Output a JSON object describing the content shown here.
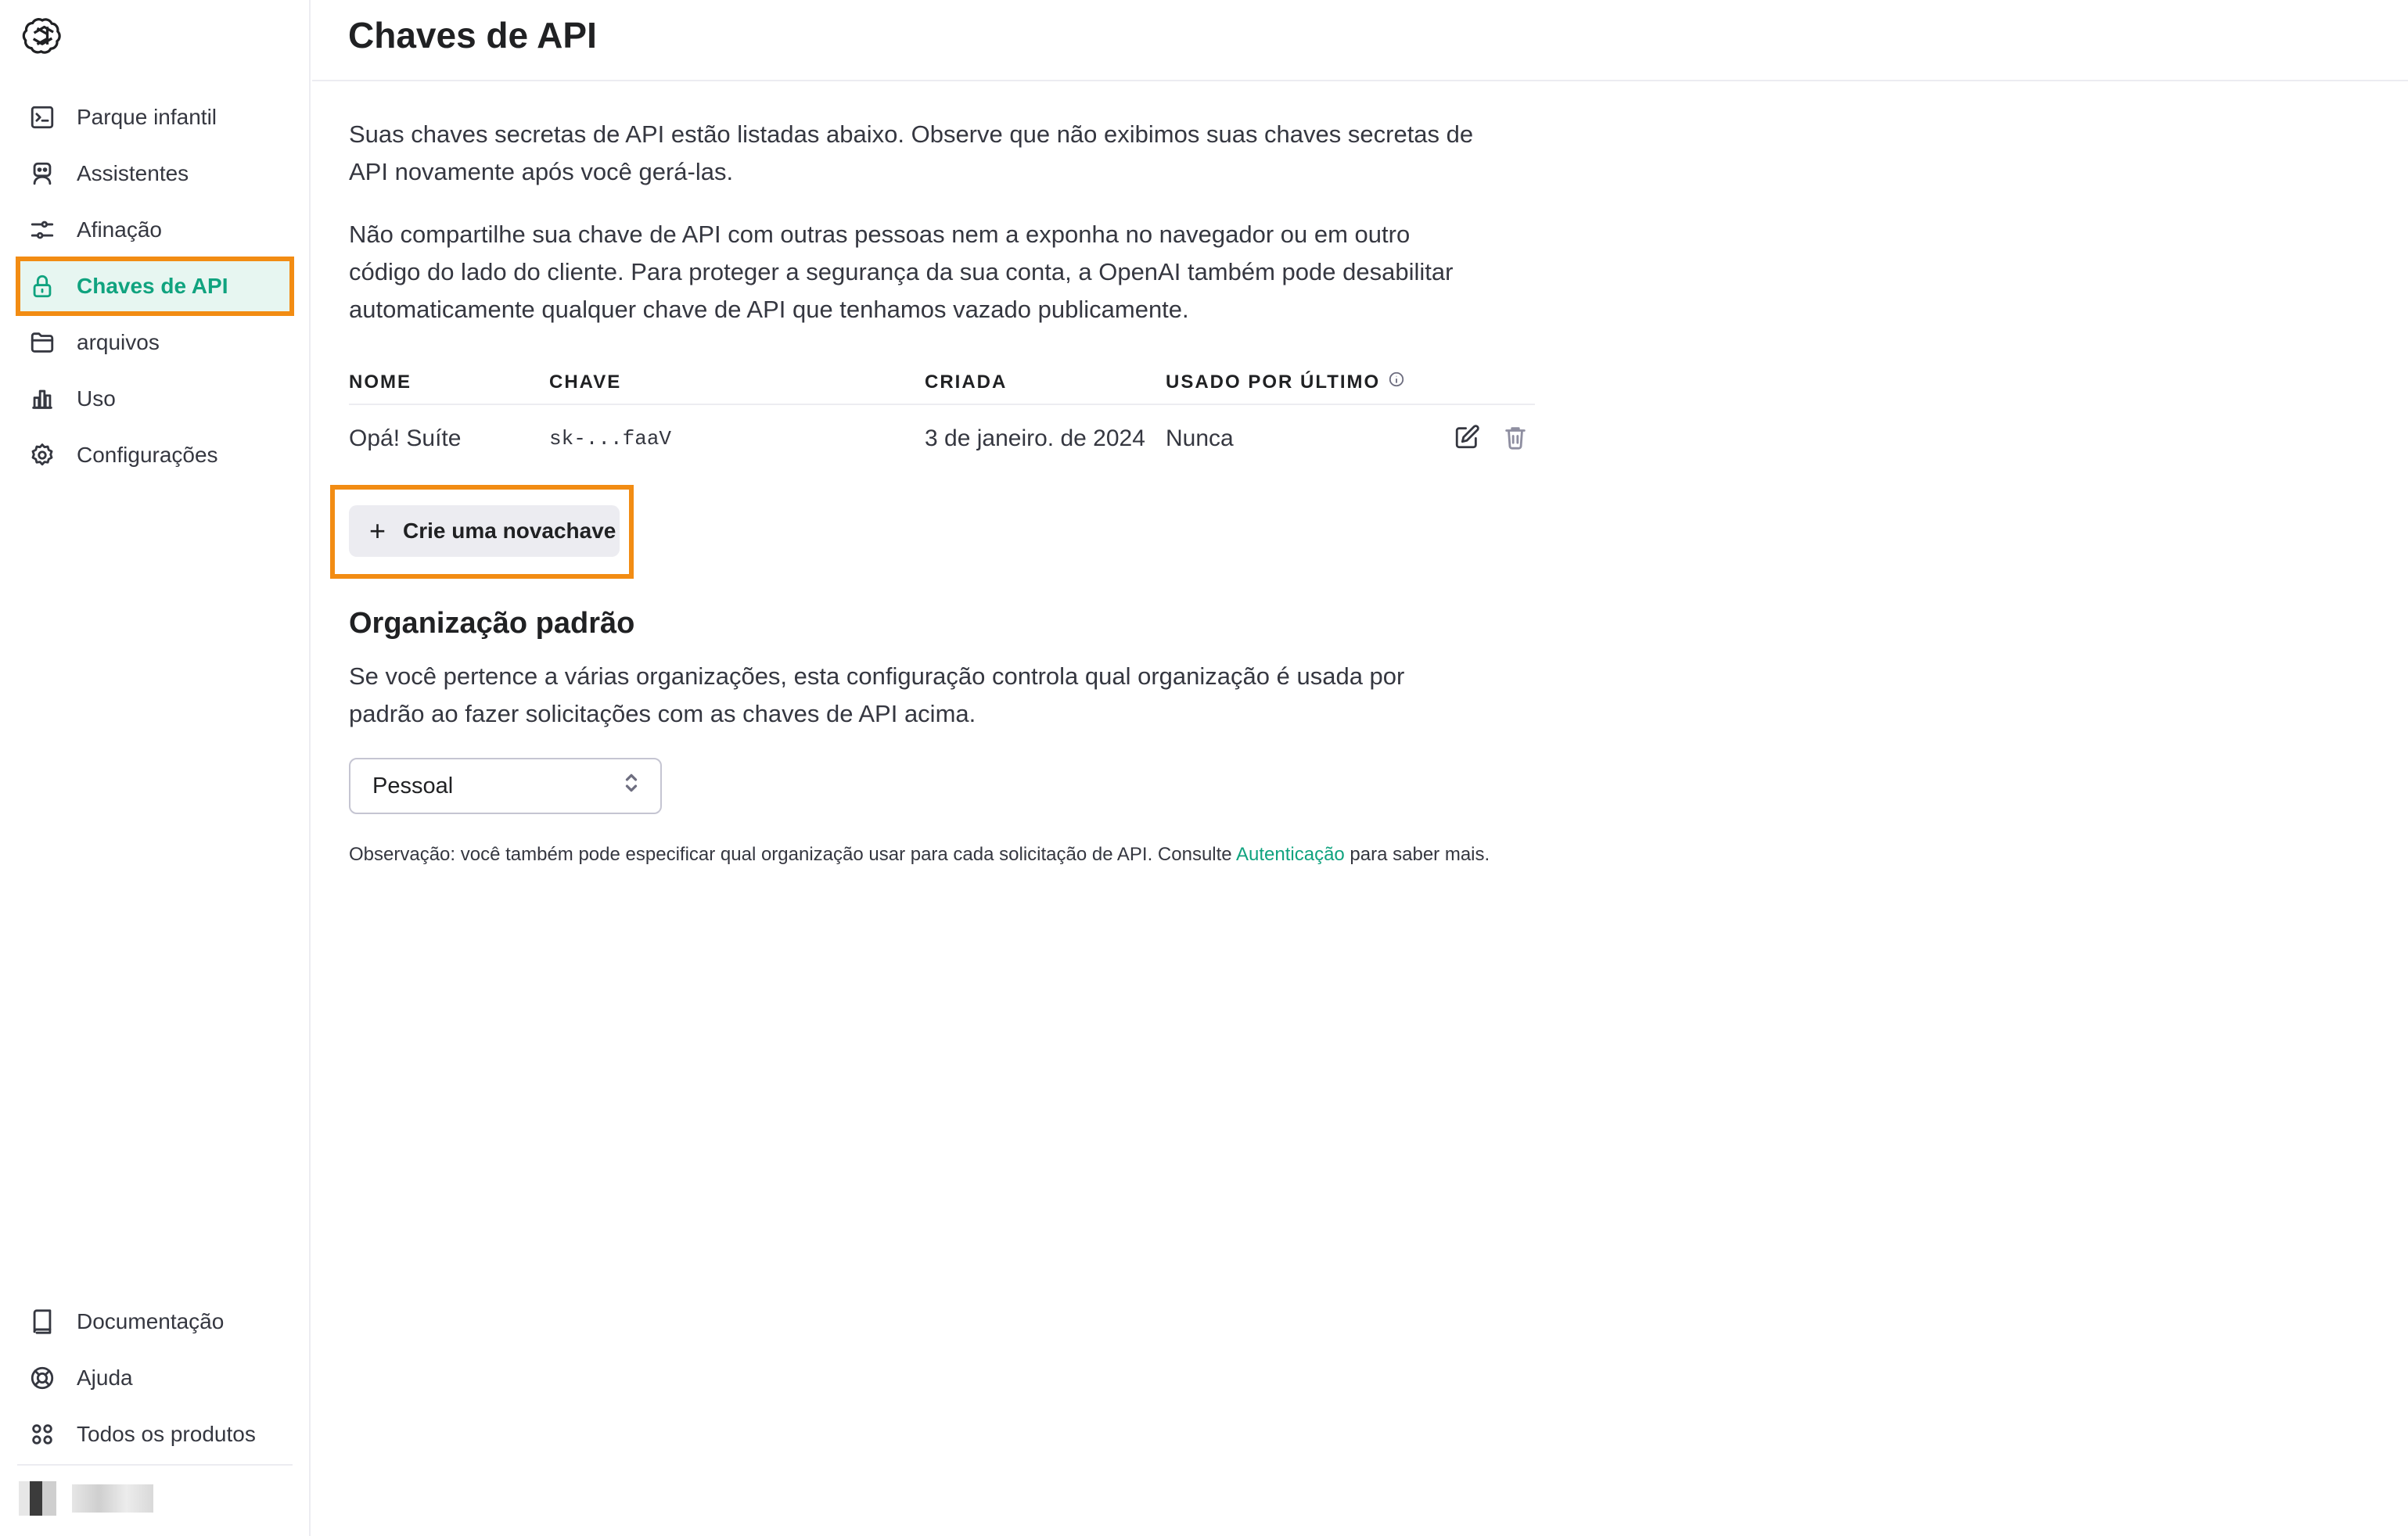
{
  "sidebar": {
    "logo": "openai-logo",
    "items": [
      {
        "label": "Parque infantil",
        "icon": "terminal-icon"
      },
      {
        "label": "Assistentes",
        "icon": "robot-icon"
      },
      {
        "label": "Afinação",
        "icon": "sliders-icon"
      },
      {
        "label": "Chaves de API",
        "icon": "lock-icon",
        "active": true
      },
      {
        "label": "arquivos",
        "icon": "folder-icon"
      },
      {
        "label": "Uso",
        "icon": "bar-chart-icon"
      },
      {
        "label": "Configurações",
        "icon": "gear-icon"
      }
    ],
    "bottom_items": [
      {
        "label": "Documentação",
        "icon": "book-icon"
      },
      {
        "label": "Ajuda",
        "icon": "lifebuoy-icon"
      },
      {
        "label": "Todos os produtos",
        "icon": "grid-icon"
      }
    ]
  },
  "header": {
    "title": "Chaves de API"
  },
  "main": {
    "intro_1": "Suas chaves secretas de API estão listadas abaixo. Observe que não exibimos suas chaves secretas de API novamente após você gerá-las.",
    "intro_2": "Não compartilhe sua chave de API com outras pessoas nem a exponha no navegador ou em outro código do lado do cliente. Para proteger a segurança da sua conta, a OpenAI também pode desabilitar automaticamente qualquer chave de API que tenhamos vazado publicamente.",
    "table": {
      "headers": [
        "NOME",
        "CHAVE",
        "CRIADA",
        "USADO POR ÚLTIMO"
      ],
      "rows": [
        {
          "name": "Opá! Suíte",
          "key": "sk-...faaV",
          "created": "3 de janeiro. de 2024",
          "last_used": "Nunca"
        }
      ]
    },
    "create_button": "Crie uma novachave",
    "org_section": {
      "title": "Organização padrão",
      "description": "Se você pertence a várias organizações, esta configuração controla qual organização é usada por padrão ao fazer solicitações com as chaves de API acima.",
      "select_value": "Pessoal",
      "note_prefix": "Observação: você também pode especificar qual organização usar para cada solicitação de API. Consulte ",
      "note_link": "Autenticação",
      "note_suffix": " para saber mais."
    }
  },
  "colors": {
    "accent": "#10a37f",
    "highlight": "#f28c13",
    "active_bg": "#e7f6f1"
  }
}
